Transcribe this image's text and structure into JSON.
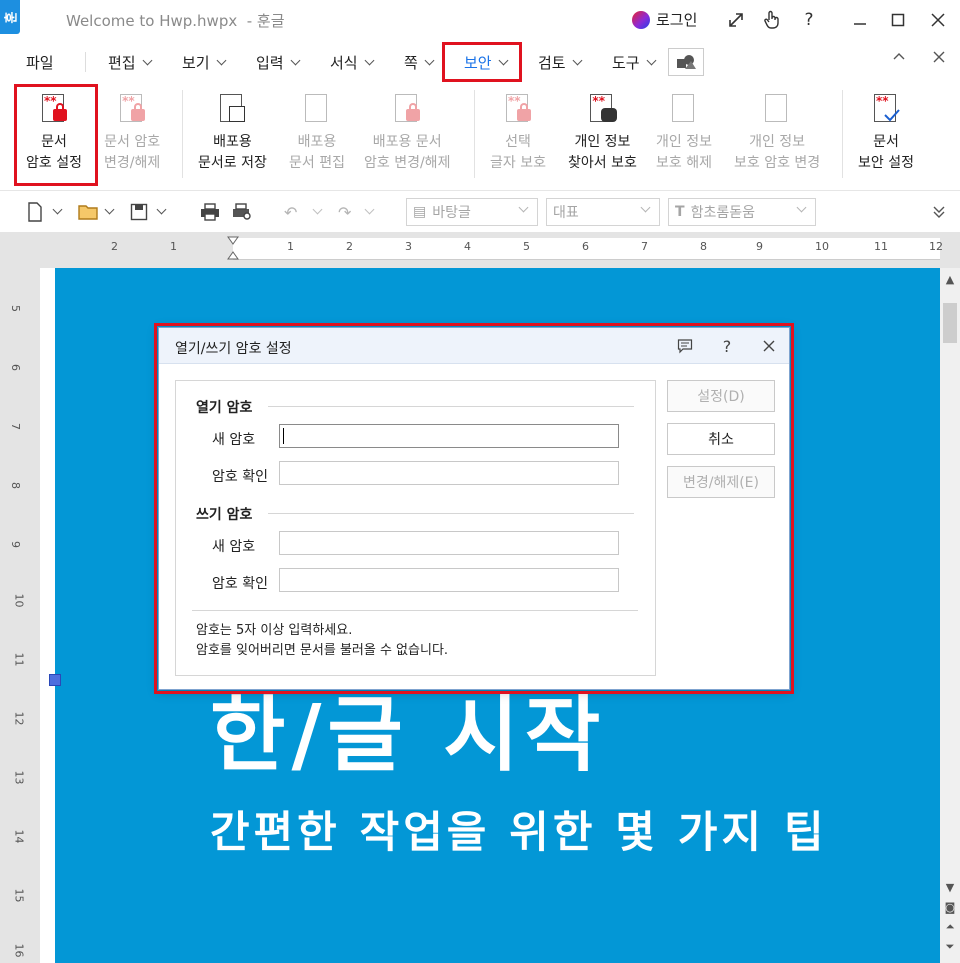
{
  "window": {
    "title": "Welcome to Hwp.hwpx  - 훈글",
    "app_badge": "훈",
    "login_label": "로그인",
    "icons": [
      "expand-icon",
      "touch-icon",
      "help-icon",
      "minimize-icon",
      "maximize-icon",
      "close-icon"
    ]
  },
  "menu": {
    "items": [
      "파일",
      "편집",
      "보기",
      "입력",
      "서식",
      "쪽",
      "보안",
      "검토",
      "도구"
    ],
    "active": "보안"
  },
  "ribbon": {
    "doc_password": {
      "line1": "문서",
      "line2": "암호 설정"
    },
    "change_password": {
      "line1": "문서 암호",
      "line2": "변경/해제"
    },
    "save_as_dist": {
      "line1": "배포용",
      "line2": "문서로 저장"
    },
    "edit_dist": {
      "line1": "배포용",
      "line2": "문서 편집"
    },
    "dist_password": {
      "line1": "배포용 문서",
      "line2": "암호 변경/해제"
    },
    "select_protect": {
      "line1": "선택",
      "line2": "글자 보호"
    },
    "find_personal": {
      "line1": "개인 정보",
      "line2": "찾아서 보호"
    },
    "release_personal": {
      "line1": "개인 정보",
      "line2": "보호 해제"
    },
    "personal_password": {
      "line1": "개인 정보",
      "line2": "보호 암호 변경"
    },
    "doc_security": {
      "line1": "문서",
      "line2": "보안 설정"
    }
  },
  "quickbar": {
    "style_select": "바탕글",
    "lang_select": "대표",
    "font_select": "함초롬돋움"
  },
  "ruler": {
    "h_numbers": [
      "2",
      "1",
      "1",
      "2",
      "3",
      "4",
      "5",
      "6",
      "7",
      "8",
      "9",
      "10",
      "11",
      "12"
    ],
    "v_numbers": [
      "5",
      "6",
      "7",
      "8",
      "9",
      "10",
      "11",
      "12",
      "13",
      "14",
      "15",
      "16"
    ]
  },
  "document": {
    "big_title": "한/글 시작",
    "subtitle": "간편한 작업을 위한 몇 가지 팁"
  },
  "dialog": {
    "title": "열기/쓰기 암호 설정",
    "open_group": "열기 암호",
    "write_group": "쓰기 암호",
    "new_password_label": "새 암호",
    "confirm_label": "암호 확인",
    "note_line1": "암호는 5자 이상 입력하세요.",
    "note_line2": "암호를 잊어버리면 문서를 불러올 수 없습니다.",
    "btn_set": "설정(D)",
    "btn_cancel": "취소",
    "btn_change": "변경/해제(E)"
  },
  "colors": {
    "highlight_box": "#e0121f",
    "page_background": "#0397d6",
    "active_menu": "#1a73e8"
  }
}
